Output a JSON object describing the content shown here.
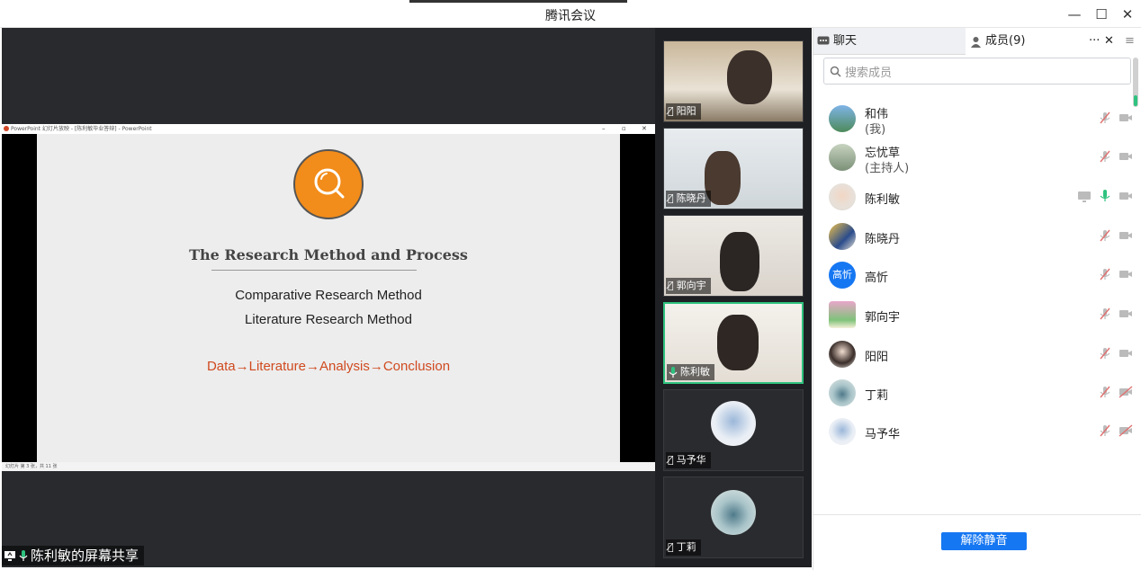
{
  "app": {
    "title": "腾讯会议"
  },
  "window": {
    "minimize": "—",
    "maximize": "☐",
    "close": "✕"
  },
  "ppt": {
    "titlebar": "PowerPoint 幻灯片放映 - [陈利敏毕业答辩] - PowerPoint",
    "status": "幻灯片 第 3 张，共 11 张",
    "slide": {
      "title": "The Research Method and Process",
      "line1": "Comparative Research Method",
      "line2": "Literature Research Method",
      "flow": "Data→Literature→Analysis→Conclusion",
      "flow_color": "#d04a1f",
      "logo_color": "#f28c1a"
    }
  },
  "share_label": "陈利敏的屏幕共享",
  "tiles": [
    {
      "name": "阳阳",
      "mic": "muted"
    },
    {
      "name": "陈晓丹",
      "mic": "muted"
    },
    {
      "name": "郭向宇",
      "mic": "muted"
    },
    {
      "name": "陈利敏",
      "mic": "on"
    },
    {
      "name": "马予华",
      "mic": "muted"
    },
    {
      "name": "丁莉",
      "mic": "muted"
    }
  ],
  "panel": {
    "chat_tab": "聊天",
    "members_tab": "成员(9)",
    "more": "···",
    "close": "✕",
    "search_placeholder": "搜索成员",
    "unmute_button": "解除静音",
    "members": [
      {
        "name": "和伟",
        "sub": "(我)",
        "mic": "muted",
        "cam": "on"
      },
      {
        "name": "忘忧草",
        "sub": "(主持人)",
        "mic": "muted",
        "cam": "on"
      },
      {
        "name": "陈利敏",
        "sub": "",
        "mic": "on",
        "cam": "on",
        "sharing": true
      },
      {
        "name": "陈晓丹",
        "sub": "",
        "mic": "muted",
        "cam": "on"
      },
      {
        "name": "高忻",
        "sub": "",
        "mic": "muted",
        "cam": "on",
        "avatar_text": "高忻"
      },
      {
        "name": "郭向宇",
        "sub": "",
        "mic": "muted",
        "cam": "on"
      },
      {
        "name": "阳阳",
        "sub": "",
        "mic": "muted",
        "cam": "on"
      },
      {
        "name": "丁莉",
        "sub": "",
        "mic": "muted",
        "cam": "off"
      },
      {
        "name": "马予华",
        "sub": "",
        "mic": "muted",
        "cam": "off"
      }
    ]
  },
  "colors": {
    "accent": "#1677f2",
    "speaking": "#2ec27e",
    "muted": "#e07070"
  }
}
